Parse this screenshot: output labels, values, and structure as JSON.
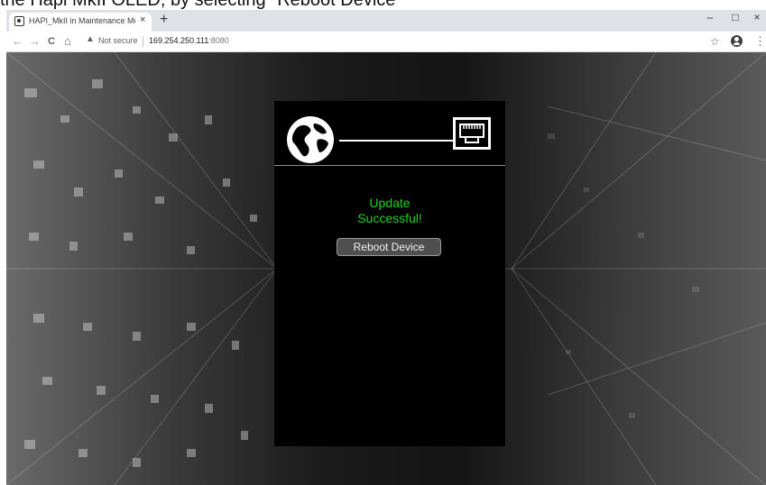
{
  "caption": "the Hapi MkII OLED, by selecting \"Reboot Device\"",
  "browser": {
    "tab_title": "HAPI_MkII in Maintenance Mode",
    "tab_close": "×",
    "new_tab": "+",
    "minimize": "–",
    "maximize": "□",
    "close": "×",
    "back": "←",
    "forward": "→",
    "reload": "C",
    "home": "⌂",
    "security_label": "Not secure",
    "url_host": "169.254.250.111",
    "url_port": ":8080",
    "icons": [
      "favicon",
      "back-icon",
      "forward-icon",
      "reload-icon",
      "home-icon",
      "warning-icon",
      "star-icon",
      "account-icon",
      "menu-icon"
    ]
  },
  "panel": {
    "status_line1": "Update",
    "status_line2": "Successful!",
    "status_color": "#1fd11f",
    "reboot_label": "Reboot Device",
    "icons": [
      "globe-icon",
      "ethernet-port-icon"
    ]
  }
}
